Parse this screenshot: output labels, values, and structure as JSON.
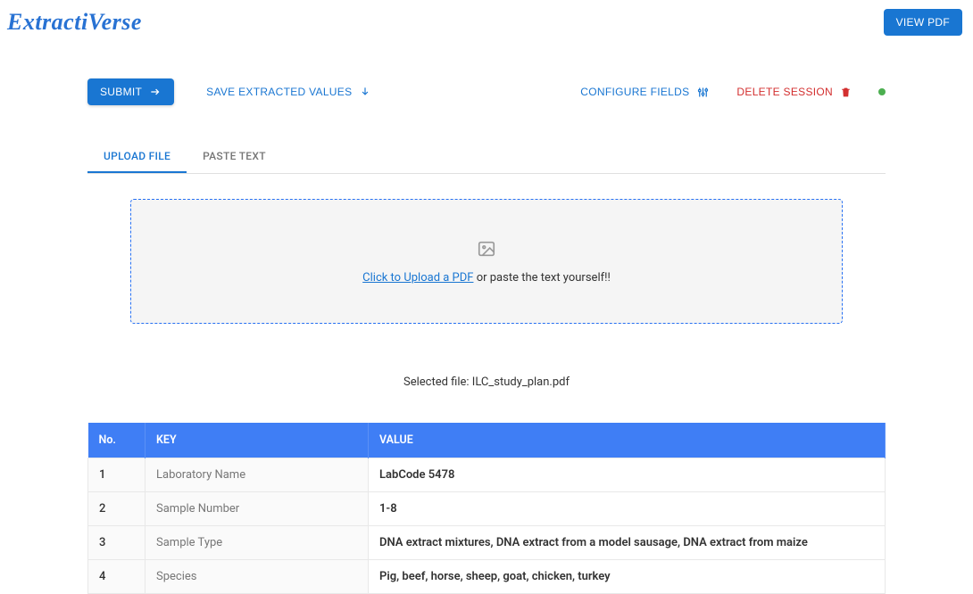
{
  "header": {
    "logo": "ExtractiVerse",
    "view_pdf_label": "VIEW PDF"
  },
  "toolbar": {
    "submit_label": "SUBMIT",
    "save_label": "SAVE EXTRACTED VALUES",
    "configure_label": "CONFIGURE FIELDS",
    "delete_label": "DELETE SESSION"
  },
  "tabs": {
    "upload_file": "UPLOAD FILE",
    "paste_text": "PASTE TEXT"
  },
  "dropzone": {
    "link_text": "Click to Upload a PDF",
    "rest_text": " or paste the text yourself!!"
  },
  "selected_file": {
    "prefix": "Selected file: ",
    "name": "ILC_study_plan.pdf"
  },
  "table": {
    "headers": {
      "no": "No.",
      "key": "KEY",
      "value": "VALUE"
    },
    "rows": [
      {
        "no": "1",
        "key": "Laboratory Name",
        "value": "LabCode 5478"
      },
      {
        "no": "2",
        "key": "Sample Number",
        "value": "1-8"
      },
      {
        "no": "3",
        "key": "Sample Type",
        "value": "DNA extract mixtures, DNA extract from a model sausage, DNA extract from maize"
      },
      {
        "no": "4",
        "key": "Species",
        "value": "Pig, beef, horse, sheep, goat, chicken, turkey"
      }
    ]
  }
}
